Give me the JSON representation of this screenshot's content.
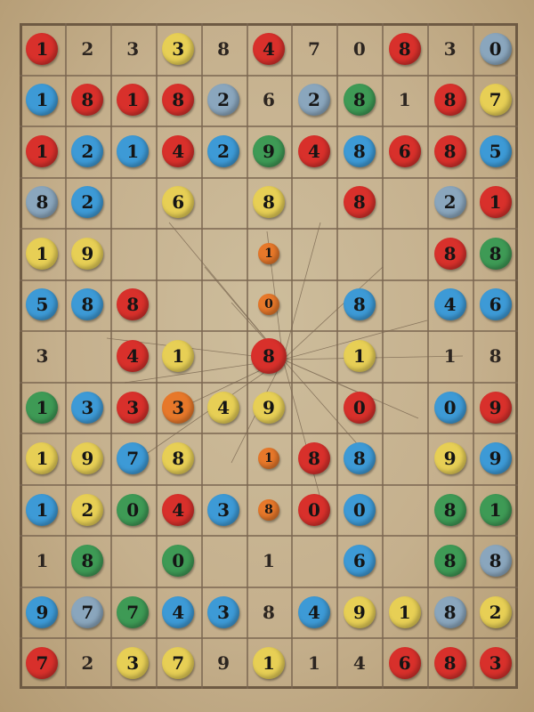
{
  "palette": {
    "red": "#d8302b",
    "blue": "#3d9ad6",
    "yellow": "#e7cf55",
    "green": "#3e9a55",
    "orange": "#e7782a",
    "greyblue": "#8aa6bd",
    "none": ""
  },
  "board": {
    "rows": [
      [
        {
          "c": "red",
          "t": "1"
        },
        {
          "c": "none",
          "t": "2"
        },
        {
          "c": "none",
          "t": "3"
        },
        {
          "c": "yellow",
          "t": "3"
        },
        {
          "c": "none",
          "t": "8"
        },
        {
          "c": "red",
          "t": "4"
        },
        {
          "c": "none",
          "t": "7"
        },
        {
          "c": "none",
          "t": "0"
        },
        {
          "c": "red",
          "t": "8"
        },
        {
          "c": "none",
          "t": "3"
        },
        {
          "c": "greyblue",
          "t": "0"
        }
      ],
      [
        {
          "c": "blue",
          "t": "1"
        },
        {
          "c": "red",
          "t": "8"
        },
        {
          "c": "red",
          "t": "1"
        },
        {
          "c": "red",
          "t": "8"
        },
        {
          "c": "greyblue",
          "t": "2"
        },
        {
          "c": "none",
          "t": "6"
        },
        {
          "c": "greyblue",
          "t": "2"
        },
        {
          "c": "green",
          "t": "8"
        },
        {
          "c": "none",
          "t": "1"
        },
        {
          "c": "red",
          "t": "8"
        },
        {
          "c": "yellow",
          "t": "7"
        }
      ],
      [
        {
          "c": "red",
          "t": "1"
        },
        {
          "c": "blue",
          "t": "2"
        },
        {
          "c": "blue",
          "t": "1"
        },
        {
          "c": "red",
          "t": "4"
        },
        {
          "c": "blue",
          "t": "2"
        },
        {
          "c": "green",
          "t": "9"
        },
        {
          "c": "red",
          "t": "4"
        },
        {
          "c": "blue",
          "t": "8"
        },
        {
          "c": "red",
          "t": "6"
        },
        {
          "c": "red",
          "t": "8"
        },
        {
          "c": "blue",
          "t": "5"
        }
      ],
      [
        {
          "c": "greyblue",
          "t": "8"
        },
        {
          "c": "blue",
          "t": "2"
        },
        {
          "c": "none",
          "t": ""
        },
        {
          "c": "yellow",
          "t": "6"
        },
        {
          "c": "none",
          "t": ""
        },
        {
          "c": "yellow",
          "t": "8"
        },
        {
          "c": "none",
          "t": ""
        },
        {
          "c": "red",
          "t": "8"
        },
        {
          "c": "none",
          "t": ""
        },
        {
          "c": "greyblue",
          "t": "2"
        },
        {
          "c": "red",
          "t": "1"
        }
      ],
      [
        {
          "c": "yellow",
          "t": "1"
        },
        {
          "c": "yellow",
          "t": "9"
        },
        {
          "c": "none",
          "t": ""
        },
        {
          "c": "none",
          "t": ""
        },
        {
          "c": "none",
          "t": ""
        },
        {
          "c": "orange",
          "t": "1",
          "s": "small"
        },
        {
          "c": "none",
          "t": ""
        },
        {
          "c": "none",
          "t": ""
        },
        {
          "c": "none",
          "t": ""
        },
        {
          "c": "red",
          "t": "8"
        },
        {
          "c": "green",
          "t": "8"
        }
      ],
      [
        {
          "c": "blue",
          "t": "5"
        },
        {
          "c": "blue",
          "t": "8"
        },
        {
          "c": "red",
          "t": "8"
        },
        {
          "c": "none",
          "t": ""
        },
        {
          "c": "none",
          "t": ""
        },
        {
          "c": "orange",
          "t": "0",
          "s": "small"
        },
        {
          "c": "none",
          "t": ""
        },
        {
          "c": "blue",
          "t": "8"
        },
        {
          "c": "none",
          "t": ""
        },
        {
          "c": "blue",
          "t": "4"
        },
        {
          "c": "blue",
          "t": "6"
        }
      ],
      [
        {
          "c": "none",
          "t": "3"
        },
        {
          "c": "none",
          "t": ""
        },
        {
          "c": "red",
          "t": "4"
        },
        {
          "c": "yellow",
          "t": "1"
        },
        {
          "c": "none",
          "t": ""
        },
        {
          "c": "red",
          "t": "8",
          "s": "big"
        },
        {
          "c": "none",
          "t": ""
        },
        {
          "c": "yellow",
          "t": "1"
        },
        {
          "c": "none",
          "t": ""
        },
        {
          "c": "none",
          "t": "1"
        },
        {
          "c": "none",
          "t": "8"
        }
      ],
      [
        {
          "c": "green",
          "t": "1"
        },
        {
          "c": "blue",
          "t": "3"
        },
        {
          "c": "red",
          "t": "3"
        },
        {
          "c": "orange",
          "t": "3"
        },
        {
          "c": "yellow",
          "t": "4"
        },
        {
          "c": "yellow",
          "t": "9"
        },
        {
          "c": "none",
          "t": ""
        },
        {
          "c": "red",
          "t": "0"
        },
        {
          "c": "none",
          "t": ""
        },
        {
          "c": "blue",
          "t": "0"
        },
        {
          "c": "red",
          "t": "9"
        }
      ],
      [
        {
          "c": "yellow",
          "t": "1"
        },
        {
          "c": "yellow",
          "t": "9"
        },
        {
          "c": "blue",
          "t": "7"
        },
        {
          "c": "yellow",
          "t": "8"
        },
        {
          "c": "none",
          "t": ""
        },
        {
          "c": "orange",
          "t": "1",
          "s": "small"
        },
        {
          "c": "red",
          "t": "8"
        },
        {
          "c": "blue",
          "t": "8"
        },
        {
          "c": "none",
          "t": ""
        },
        {
          "c": "yellow",
          "t": "9"
        },
        {
          "c": "blue",
          "t": "9"
        }
      ],
      [
        {
          "c": "blue",
          "t": "1"
        },
        {
          "c": "yellow",
          "t": "2"
        },
        {
          "c": "green",
          "t": "0"
        },
        {
          "c": "red",
          "t": "4"
        },
        {
          "c": "blue",
          "t": "3"
        },
        {
          "c": "orange",
          "t": "8",
          "s": "small"
        },
        {
          "c": "red",
          "t": "0"
        },
        {
          "c": "blue",
          "t": "0"
        },
        {
          "c": "none",
          "t": ""
        },
        {
          "c": "green",
          "t": "8"
        },
        {
          "c": "green",
          "t": "1"
        }
      ],
      [
        {
          "c": "none",
          "t": "1"
        },
        {
          "c": "green",
          "t": "8"
        },
        {
          "c": "none",
          "t": ""
        },
        {
          "c": "green",
          "t": "0"
        },
        {
          "c": "none",
          "t": ""
        },
        {
          "c": "none",
          "t": "1"
        },
        {
          "c": "none",
          "t": ""
        },
        {
          "c": "blue",
          "t": "6"
        },
        {
          "c": "none",
          "t": ""
        },
        {
          "c": "green",
          "t": "8"
        },
        {
          "c": "greyblue",
          "t": "8"
        }
      ],
      [
        {
          "c": "blue",
          "t": "9"
        },
        {
          "c": "greyblue",
          "t": "7"
        },
        {
          "c": "green",
          "t": "7"
        },
        {
          "c": "blue",
          "t": "4"
        },
        {
          "c": "blue",
          "t": "3"
        },
        {
          "c": "none",
          "t": "8"
        },
        {
          "c": "blue",
          "t": "4"
        },
        {
          "c": "yellow",
          "t": "9"
        },
        {
          "c": "yellow",
          "t": "1"
        },
        {
          "c": "greyblue",
          "t": "8"
        },
        {
          "c": "yellow",
          "t": "2"
        }
      ],
      [
        {
          "c": "red",
          "t": "7"
        },
        {
          "c": "none",
          "t": "2"
        },
        {
          "c": "yellow",
          "t": "3"
        },
        {
          "c": "yellow",
          "t": "7"
        },
        {
          "c": "none",
          "t": "9"
        },
        {
          "c": "yellow",
          "t": "1"
        },
        {
          "c": "none",
          "t": "1"
        },
        {
          "c": "none",
          "t": "4"
        },
        {
          "c": "red",
          "t": "6"
        },
        {
          "c": "red",
          "t": "8"
        },
        {
          "c": "red",
          "t": "3"
        }
      ]
    ]
  }
}
